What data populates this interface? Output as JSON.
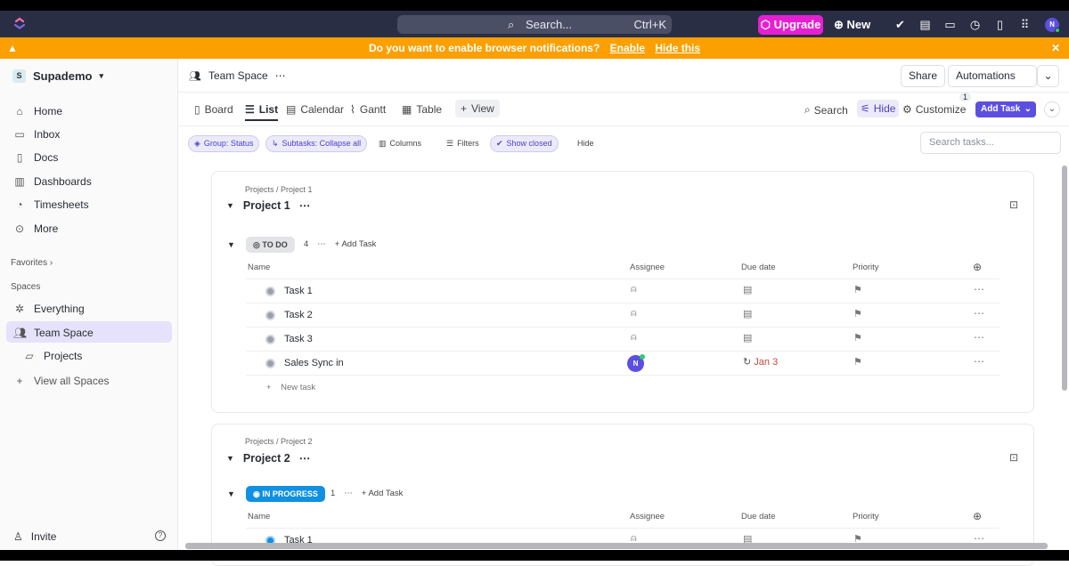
{
  "topbar": {
    "search_placeholder": "Search...",
    "search_shortcut": "Ctrl+K",
    "upgrade_label": "Upgrade",
    "new_label": "New",
    "avatar_initial": "N"
  },
  "banner": {
    "message": "Do you want to enable browser notifications?",
    "enable_label": "Enable",
    "hide_label": "Hide this"
  },
  "sidebar": {
    "workspace_initial": "S",
    "workspace_name": "Supademo",
    "nav": [
      "Home",
      "Inbox",
      "Docs",
      "Dashboards",
      "Timesheets",
      "More"
    ],
    "favorites_label": "Favorites",
    "spaces_label": "Spaces",
    "everything_label": "Everything",
    "team_space_label": "Team Space",
    "projects_label": "Projects",
    "view_all_spaces_label": "View all Spaces",
    "invite_label": "Invite"
  },
  "header": {
    "space_name": "Team Space",
    "share_label": "Share",
    "automations_label": "Automations",
    "automations_count": "1"
  },
  "views": {
    "tabs": [
      "Board",
      "List",
      "Calendar",
      "Gantt",
      "Table"
    ],
    "add_view_label": "View",
    "search_label": "Search",
    "hide_label": "Hide",
    "customize_label": "Customize",
    "add_task_label": "Add Task"
  },
  "filters": {
    "group_label": "Group: Status",
    "subtasks_label": "Subtasks: Collapse all",
    "columns_label": "Columns",
    "filters_label": "Filters",
    "show_closed_label": "Show closed",
    "hide_label": "Hide",
    "search_placeholder": "Search tasks..."
  },
  "projects": [
    {
      "crumb": "Projects / Project 1",
      "title": "Project 1",
      "status": "TO DO",
      "count": "4",
      "add_task_label": "Add Task",
      "columns": [
        "Name",
        "Assignee",
        "Due date",
        "Priority"
      ],
      "tasks": [
        {
          "name": "Task 1",
          "due": ""
        },
        {
          "name": "Task 2",
          "due": ""
        },
        {
          "name": "Task 3",
          "due": ""
        },
        {
          "name": "Sales Sync in",
          "due": "Jan 3",
          "assignee": "N"
        }
      ],
      "new_task_label": "New task"
    },
    {
      "crumb": "Projects / Project 2",
      "title": "Project 2",
      "status": "IN PROGRESS",
      "count": "1",
      "add_task_label": "Add Task",
      "columns": [
        "Name",
        "Assignee",
        "Due date",
        "Priority"
      ],
      "tasks": [
        {
          "name": "Task 1",
          "due": ""
        }
      ]
    }
  ],
  "colors": {
    "accent": "#5c4fe0",
    "banner": "#fba000",
    "upgrade": "#e71fd3",
    "in_progress": "#1090e0",
    "topbar": "#2a2e45"
  }
}
